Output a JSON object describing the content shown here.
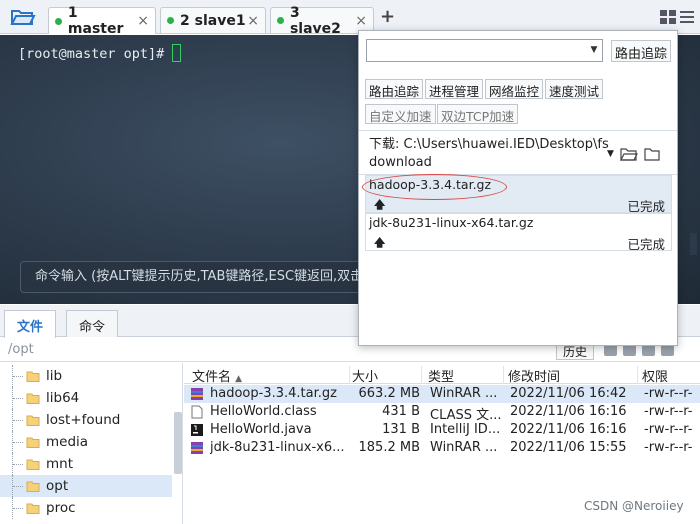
{
  "tabs": [
    {
      "label": "1 master",
      "close": "×"
    },
    {
      "label": "2 slave1",
      "close": "×"
    },
    {
      "label": "3 slave2",
      "close": "×"
    }
  ],
  "new_tab": "+",
  "terminal": {
    "prompt": "[root@master opt]#",
    "command_hint": "命令输入 (按ALT键提示历史,TAB键路径,ESC键返回,双击"
  },
  "panel_tabs": [
    "文件",
    "命令"
  ],
  "current_path": "/opt",
  "history_btn": "历史",
  "tree": [
    "lib",
    "lib64",
    "lost+found",
    "media",
    "mnt",
    "opt",
    "proc"
  ],
  "tree_selected": "opt",
  "file_columns": [
    "文件名",
    "大小",
    "类型",
    "修改时间",
    "权限"
  ],
  "files": [
    {
      "name": "hadoop-3.3.4.tar.gz",
      "size": "663.2 MB",
      "type": "WinRAR ...",
      "mtime": "2022/11/06 16:42",
      "perm": "-rw-r--r-",
      "icon": "archive-icon"
    },
    {
      "name": "HelloWorld.class",
      "size": "431 B",
      "type": "CLASS 文...",
      "mtime": "2022/11/06 16:16",
      "perm": "-rw-r--r-",
      "icon": "file-icon"
    },
    {
      "name": "HelloWorld.java",
      "size": "131 B",
      "type": "IntelliJ ID...",
      "mtime": "2022/11/06 16:16",
      "perm": "-rw-r--r-",
      "icon": "java-file-icon"
    },
    {
      "name": "jdk-8u231-linux-x6...",
      "size": "185.2 MB",
      "type": "WinRAR ...",
      "mtime": "2022/11/06 15:55",
      "perm": "-rw-r--r-",
      "icon": "archive-icon"
    }
  ],
  "popup": {
    "search_value": "",
    "route_btn": "路由追踪",
    "tools": [
      "路由追踪",
      "进程管理",
      "网络监控",
      "速度测试"
    ],
    "accel": [
      "自定义加速",
      "双边TCP加速"
    ],
    "download_label": "下载: C:\\Users\\huawei.IED\\Desktop\\fsdownload",
    "downloads": [
      {
        "name": "hadoop-3.3.4.tar.gz",
        "arrow": "🡅",
        "status": "已完成"
      },
      {
        "name": "jdk-8u231-linux-x64.tar.gz",
        "arrow": "🡅",
        "status": "已完成"
      }
    ]
  },
  "watermark": "CSDN @Neroiiey",
  "colors": {
    "accent": "#2a74c8",
    "green_dot": "#2ab24a",
    "highlight": "#d94a4a"
  }
}
